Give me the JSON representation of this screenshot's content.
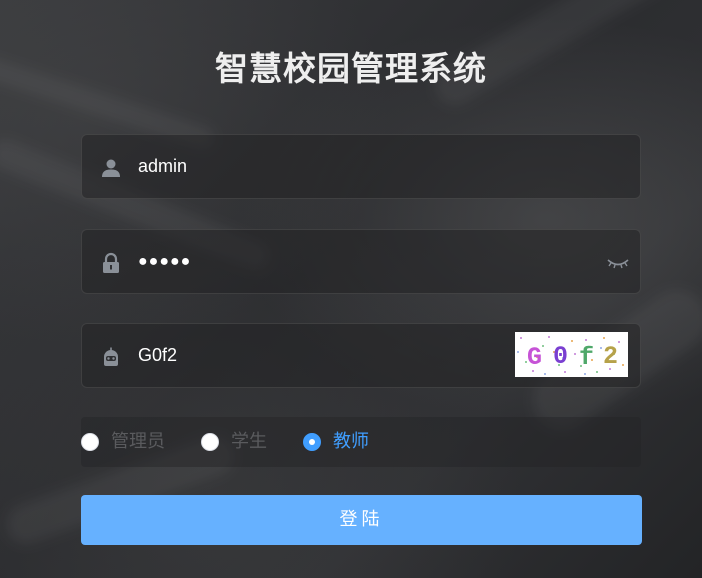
{
  "app": {
    "title": "智慧校园管理系统"
  },
  "username": {
    "value": "admin",
    "icon": "user-icon"
  },
  "password": {
    "masked_value": "●●●●●",
    "icon": "lock-icon",
    "toggle_icon": "eye-closed-icon"
  },
  "captcha": {
    "value": "G0f2",
    "image_text": "G0f2",
    "icon": "robot-icon"
  },
  "roles": {
    "options": [
      "管理员",
      "学生",
      "教师"
    ],
    "selected": "教师"
  },
  "login_button": {
    "label": "登陆"
  },
  "colors": {
    "accent": "#409eff",
    "button": "#66b1ff",
    "background": "#2f3033"
  }
}
